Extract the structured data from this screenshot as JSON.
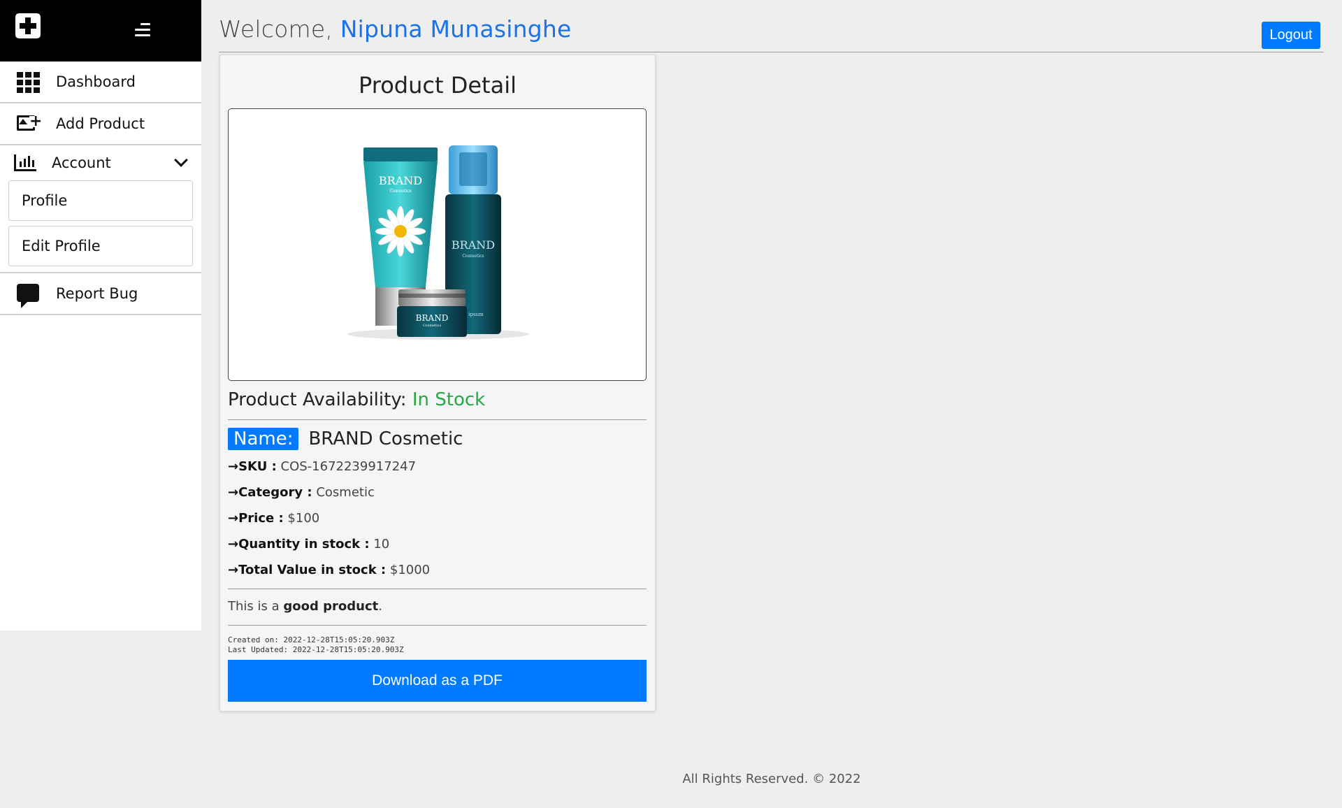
{
  "header": {
    "welcome_prefix": "Welcome,",
    "user_name": "Nipuna Munasinghe",
    "logout_label": "Logout"
  },
  "sidebar": {
    "logo_icon": "plus-square-icon",
    "menu_icon": "hamburger-icon",
    "items": [
      {
        "label": "Dashboard",
        "icon": "grid-icon"
      },
      {
        "label": "Add Product",
        "icon": "add-image-icon"
      },
      {
        "label": "Account",
        "icon": "bar-chart-icon",
        "expanded": true,
        "children": [
          {
            "label": "Profile"
          },
          {
            "label": "Edit Profile"
          }
        ]
      },
      {
        "label": "Report Bug",
        "icon": "chat-icon"
      }
    ]
  },
  "product": {
    "card_title": "Product Detail",
    "availability_label": "Product Availability:",
    "availability_value": "In Stock",
    "name_label": "Name:",
    "name_value": "BRAND Cosmetic",
    "image_texts": {
      "brand": "BRAND",
      "sub": "Cosmetics",
      "jar_sub": "Cosmetics",
      "ipsum": "ipsum"
    },
    "fields": [
      {
        "key": "SKU :",
        "value": "COS-1672239917247"
      },
      {
        "key": "Category :",
        "value": "Cosmetic"
      },
      {
        "key": "Price :",
        "value": "$100"
      },
      {
        "key": "Quantity in stock :",
        "value": "10"
      },
      {
        "key": "Total Value in stock :",
        "value": "$1000"
      }
    ],
    "arrow": "→",
    "description_prefix": "This is a",
    "description_bold": "good product",
    "description_suffix": ".",
    "created_on": "Created on: 2022-12-28T15:05:20.903Z",
    "last_updated": "Last Updated: 2022-12-28T15:05:20.903Z",
    "pdf_button": "Download as a PDF"
  },
  "colors": {
    "accent": "#007bff",
    "in_stock": "#28a745",
    "user_name": "#1a73e8"
  },
  "footer": {
    "text": "All Rights Reserved. © 2022"
  }
}
